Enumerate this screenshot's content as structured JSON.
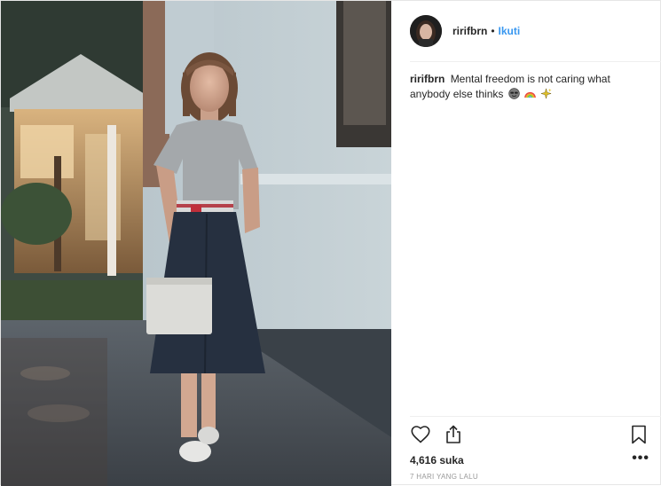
{
  "post": {
    "username": "ririfbrn",
    "separator": "•",
    "follow_label": "Ikuti",
    "caption_text": "Mental freedom is not caring what anybody else thinks",
    "caption_emojis": [
      "smiling-face-with-sunglasses-emoji",
      "rainbow-emoji",
      "sparkle-emoji"
    ],
    "likes": "4,616 suka",
    "more_label": "•••",
    "timestamp": "7 HARI YANG LALU"
  },
  "icons": {
    "like": "heart-icon",
    "share": "share-icon",
    "save": "bookmark-icon",
    "more": "more-options-icon"
  },
  "colors": {
    "link_blue": "#3897f0",
    "text": "#262626",
    "muted": "#999999",
    "divider": "#efefef"
  }
}
